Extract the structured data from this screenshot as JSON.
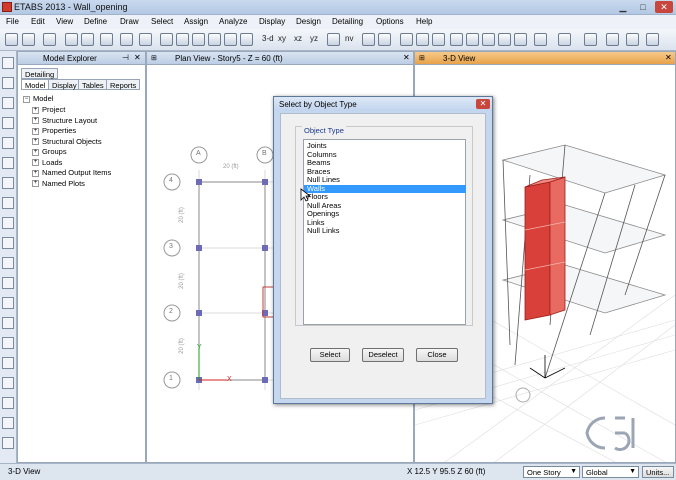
{
  "app": {
    "title": "ETABS 2013 - Wall_opening"
  },
  "menu": [
    "File",
    "Edit",
    "View",
    "Define",
    "Draw",
    "Select",
    "Assign",
    "Analyze",
    "Display",
    "Design",
    "Detailing",
    "Options",
    "Help"
  ],
  "toolbar": {
    "view_3d": "3-d",
    "view_xy": "xy",
    "view_xz": "xz",
    "view_yz": "yz",
    "view_nv": "nv"
  },
  "explorer": {
    "title": "Model Explorer",
    "detailing_tab": "Detailing",
    "tabs": [
      "Model",
      "Display",
      "Tables",
      "Reports"
    ],
    "root": "Model",
    "items": [
      "Project",
      "Structure Layout",
      "Properties",
      "Structural Objects",
      "Groups",
      "Loads",
      "Named Output Items",
      "Named Plots"
    ]
  },
  "plan_view": {
    "title": "Plan View - Story5 - Z = 60 (ft)",
    "grid_cols": [
      "A",
      "B"
    ],
    "grid_rows": [
      "4",
      "3",
      "2",
      "1"
    ],
    "dim_top": "20 (ft)",
    "dim_side": [
      "20 (ft)",
      "20 (ft)",
      "20 (ft)"
    ],
    "axis_x": "X",
    "axis_y": "Y"
  },
  "view_3d": {
    "title": "3-D View"
  },
  "dialog": {
    "title": "Select by Object Type",
    "group_label": "Object Type",
    "items": [
      "Joints",
      "Columns",
      "Beams",
      "Braces",
      "Null Lines",
      "Walls",
      "Floors",
      "Null Areas",
      "Openings",
      "Links",
      "Null Links"
    ],
    "selected": "Walls",
    "buttons": {
      "select": "Select",
      "deselect": "Deselect",
      "close": "Close"
    }
  },
  "status": {
    "left": "3-D View",
    "coords": "X 12.5  Y 95.5  Z 60 (ft)",
    "story": "One Story",
    "coord_sys": "Global",
    "units": "Units..."
  },
  "colors": {
    "wall_red": "#d9403a",
    "selection_blue": "#3399ff",
    "active_tab": "#e8a24a"
  }
}
